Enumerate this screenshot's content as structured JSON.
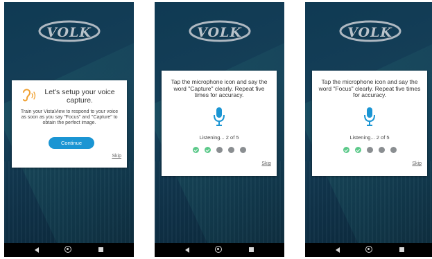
{
  "brand": {
    "logo_text": "VOLK"
  },
  "screen1": {
    "title": "Let's setup your voice capture.",
    "body": "Train your VistaView to respond to your voice as soon as you say \"Focus\" and \"Capture\" to obtain the perfect image.",
    "continue_label": "Continue",
    "skip_label": "Skip"
  },
  "screen2": {
    "instruction": "Tap the microphone icon and say the word \"Capture\" clearly. Repeat five times for accuracy.",
    "listening": "Listening... 2 of 5",
    "progress": {
      "completed": 2,
      "total": 5
    },
    "skip_label": "Skip"
  },
  "screen3": {
    "instruction": "Tap the microphone icon and say the word \"Focus\" clearly. Repeat five times for accuracy.",
    "listening": "Listening... 2 of 5",
    "progress": {
      "completed": 2,
      "total": 5
    },
    "skip_label": "Skip"
  },
  "icons": {
    "ear": "ear-sound-icon",
    "mic": "microphone-icon",
    "nav_back": "back-triangle-icon",
    "nav_home": "home-circle-icon",
    "nav_recent": "recent-apps-square-icon"
  },
  "colors": {
    "accent": "#1b95d3",
    "ear_icon": "#f0a030",
    "progress_done": "#5cc98a",
    "progress_pending": "#8a8e91",
    "background": "#123a52"
  }
}
